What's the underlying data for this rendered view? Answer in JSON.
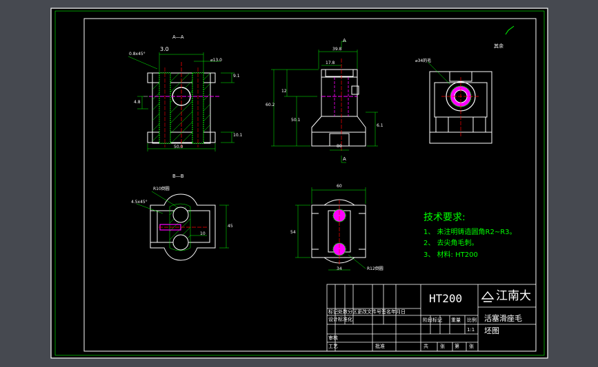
{
  "drawing": {
    "section_aa_label": "A—A",
    "section_bb_label": "B—B",
    "view_marks": [
      "A",
      "A"
    ],
    "surface_finish_rest": "其余",
    "dimensions": {
      "aa": [
        "0.8x45°",
        "3.0",
        "⌀13.0",
        "4.8",
        "9.1",
        "10.1",
        "50.0"
      ],
      "front": [
        "39.8",
        "17.8",
        "12",
        "50.1",
        "60.2",
        "80"
      ],
      "side": [
        "⌀34的毛",
        "6.1"
      ],
      "bb": [
        "R10倒圆",
        "4.5x45°",
        "10",
        "45"
      ],
      "bottom": [
        "60",
        "54",
        "34",
        "R12倒圆"
      ]
    }
  },
  "technical_requirements": {
    "title": "技术要求:",
    "items": [
      "1、 未注明铸造圆角R2~R3。",
      "2、 去尖角毛刺。",
      "3、 材料: HT200"
    ]
  },
  "title_block": {
    "material": "HT200",
    "school": "江南大",
    "part_name": "活塞滑座毛",
    "drawing_type": "坯图",
    "scale_row": [
      "阶段标记",
      "重量",
      "比例"
    ],
    "scale_value": "1:1",
    "sheet_row": [
      "共",
      "张",
      "第",
      "张"
    ],
    "rev_row": "标记处数分区更改文件号签名年月日",
    "design_row": "设计标准化",
    "check_label": "审核",
    "process_label": "工艺",
    "approve_label": "批准"
  },
  "colors": {
    "background": "#464950",
    "paper": "#000000",
    "frame": "#ffffff",
    "border": "#00ff00",
    "outline": "#ffffff",
    "dimension": "#00ff00",
    "hatch": "#00ff00",
    "hole_fill": "#ff00ff",
    "center_line": "#ff0000"
  }
}
